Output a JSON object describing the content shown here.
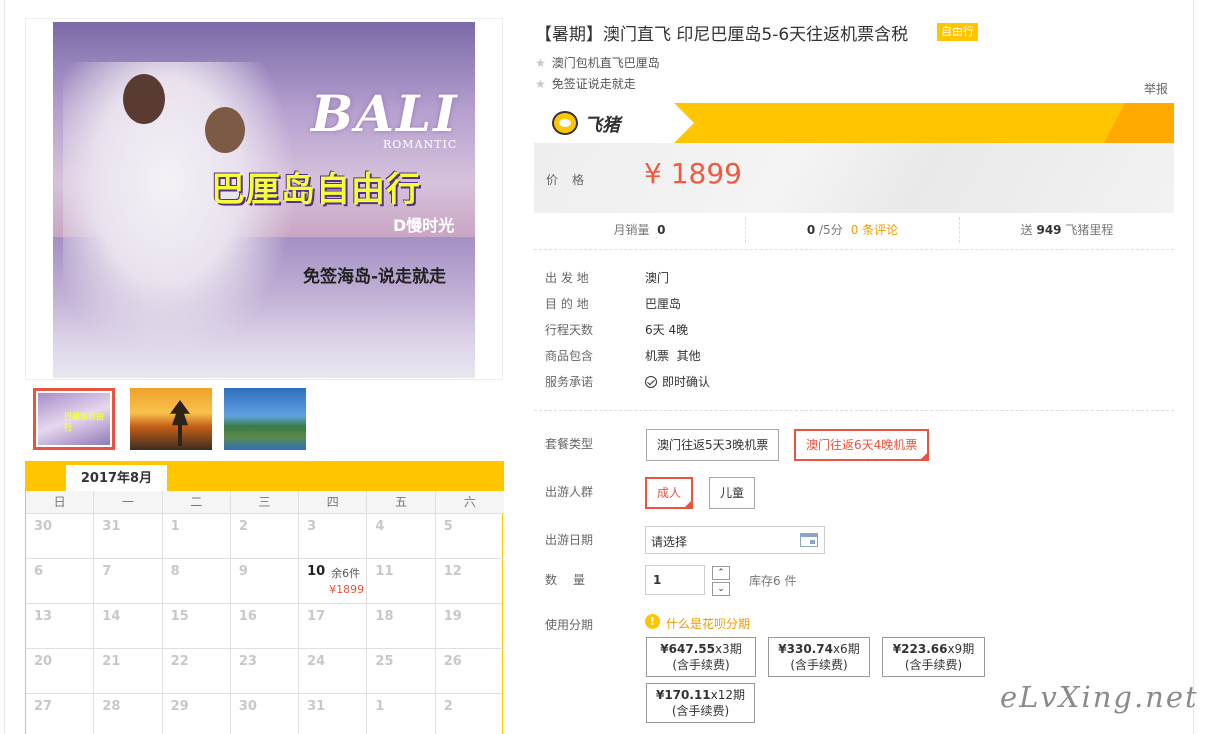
{
  "gallery": {
    "main_image": {
      "title": "BALI",
      "subtitle": "ROMANTIC",
      "headline": "巴厘岛自由行",
      "slogan": "D慢时光",
      "visa_text": "免签海岛-说走就走"
    },
    "thumbnails": [
      {
        "name": "thumbnail-couple",
        "selected": true
      },
      {
        "name": "thumbnail-sunset-pagoda",
        "selected": false
      },
      {
        "name": "thumbnail-coast-temple",
        "selected": false
      }
    ],
    "thumb1_text": "巴厘岛自由行"
  },
  "calendar": {
    "month": "2017年8月",
    "weekdays": [
      "日",
      "一",
      "二",
      "三",
      "四",
      "五",
      "六"
    ],
    "days": [
      {
        "d": "30"
      },
      {
        "d": "31"
      },
      {
        "d": "1"
      },
      {
        "d": "2"
      },
      {
        "d": "3"
      },
      {
        "d": "4"
      },
      {
        "d": "5"
      },
      {
        "d": "6"
      },
      {
        "d": "7"
      },
      {
        "d": "8"
      },
      {
        "d": "9"
      },
      {
        "d": "10",
        "stock": "余6件",
        "price": "¥1899",
        "active": true
      },
      {
        "d": "11"
      },
      {
        "d": "12"
      },
      {
        "d": "13"
      },
      {
        "d": "14"
      },
      {
        "d": "15"
      },
      {
        "d": "16"
      },
      {
        "d": "17"
      },
      {
        "d": "18"
      },
      {
        "d": "19"
      },
      {
        "d": "20"
      },
      {
        "d": "21"
      },
      {
        "d": "22"
      },
      {
        "d": "23"
      },
      {
        "d": "24"
      },
      {
        "d": "25"
      },
      {
        "d": "26"
      },
      {
        "d": "27"
      },
      {
        "d": "28"
      },
      {
        "d": "29"
      },
      {
        "d": "30"
      },
      {
        "d": "31"
      },
      {
        "d": "1"
      },
      {
        "d": "2"
      }
    ]
  },
  "product": {
    "title": "【暑期】澳门直飞 印尼巴厘岛5-6天往返机票含税",
    "badge": "自由行",
    "features": [
      "澳门包机直飞巴厘岛",
      "免签证说走就走"
    ],
    "report_link": "举报",
    "brand_name": "飞猪",
    "price_label": "价格",
    "price": "¥ 1899",
    "stats": {
      "monthly_sales_label": "月销量",
      "monthly_sales": "0",
      "rating": "0",
      "rating_suffix": "/5分",
      "reviews_link": "0 条评论",
      "mileage_prefix": "送",
      "mileage": "949",
      "mileage_suffix": "飞猪里程"
    },
    "info": [
      {
        "label": "出 发 地",
        "value": "澳门"
      },
      {
        "label": "目 的 地",
        "value": "巴厘岛"
      },
      {
        "label": "行程天数",
        "value": "6天 4晚"
      },
      {
        "label": "商品包含",
        "value": "机票  其他"
      },
      {
        "label": "服务承诺",
        "value": "即时确认"
      }
    ]
  },
  "options": {
    "package_label": "套餐类型",
    "packages": [
      "澳门往返5天3晚机票",
      "澳门往返6天4晚机票"
    ],
    "traveler_label": "出游人群",
    "travelers": [
      "成人",
      "儿童"
    ],
    "date_label": "出游日期",
    "date_placeholder": "请选择",
    "qty_label": "数量",
    "qty_value": "1",
    "qty_up": "⌃",
    "qty_down": "⌄",
    "stock": "库存6 件",
    "installment_label": "使用分期",
    "huabei_link": "什么是花呗分期",
    "installments": [
      {
        "amount": "¥647.55",
        "periods": "x3期",
        "fee": "(含手续费)"
      },
      {
        "amount": "¥330.74",
        "periods": "x6期",
        "fee": "(含手续费)"
      },
      {
        "amount": "¥223.66",
        "periods": "x9期",
        "fee": "(含手续费)"
      },
      {
        "amount": "¥170.11",
        "periods": "x12期",
        "fee": "(含手续费)"
      }
    ]
  },
  "watermark": "eLvXing.net"
}
